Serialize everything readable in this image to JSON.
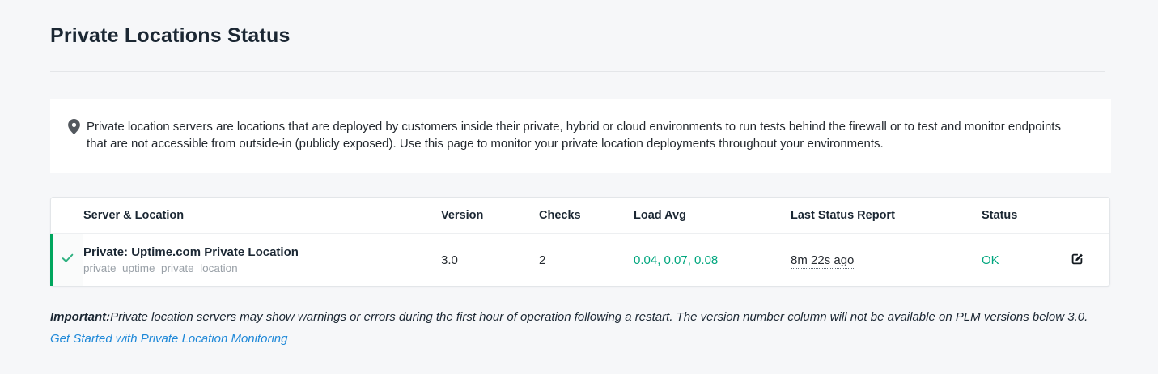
{
  "page": {
    "title": "Private Locations Status"
  },
  "info_banner": {
    "icon": "location-pin-icon",
    "text": "Private location servers are locations that are deployed by customers inside their private, hybrid or cloud environments to run tests behind the firewall or to test and monitor endpoints that are not accessible from outside-in (publicly exposed). Use this page to monitor your private location deployments throughout your environments."
  },
  "table": {
    "columns": [
      "Server & Location",
      "Version",
      "Checks",
      "Load Avg",
      "Last Status Report",
      "Status"
    ],
    "rows": [
      {
        "status_icon": "check-icon",
        "name": "Private: Uptime.com Private Location",
        "slug": "private_uptime_private_location",
        "version": "3.0",
        "checks": "2",
        "load_avg": "0.04, 0.07, 0.08",
        "last_status_report": "8m 22s ago",
        "status": "OK",
        "action_icon": "edit-icon"
      }
    ]
  },
  "note": {
    "important_label": "Important:",
    "text": "Private location servers may show warnings or errors during the first hour of operation following a restart. The version number column will not be available on PLM versions below 3.0.",
    "link": "Get Started with Private Location Monitoring"
  },
  "colors": {
    "accent_green": "#00a67e",
    "green_bar": "#00a65d",
    "link_blue": "#1e88d8",
    "page_background": "#f6f7f9"
  }
}
